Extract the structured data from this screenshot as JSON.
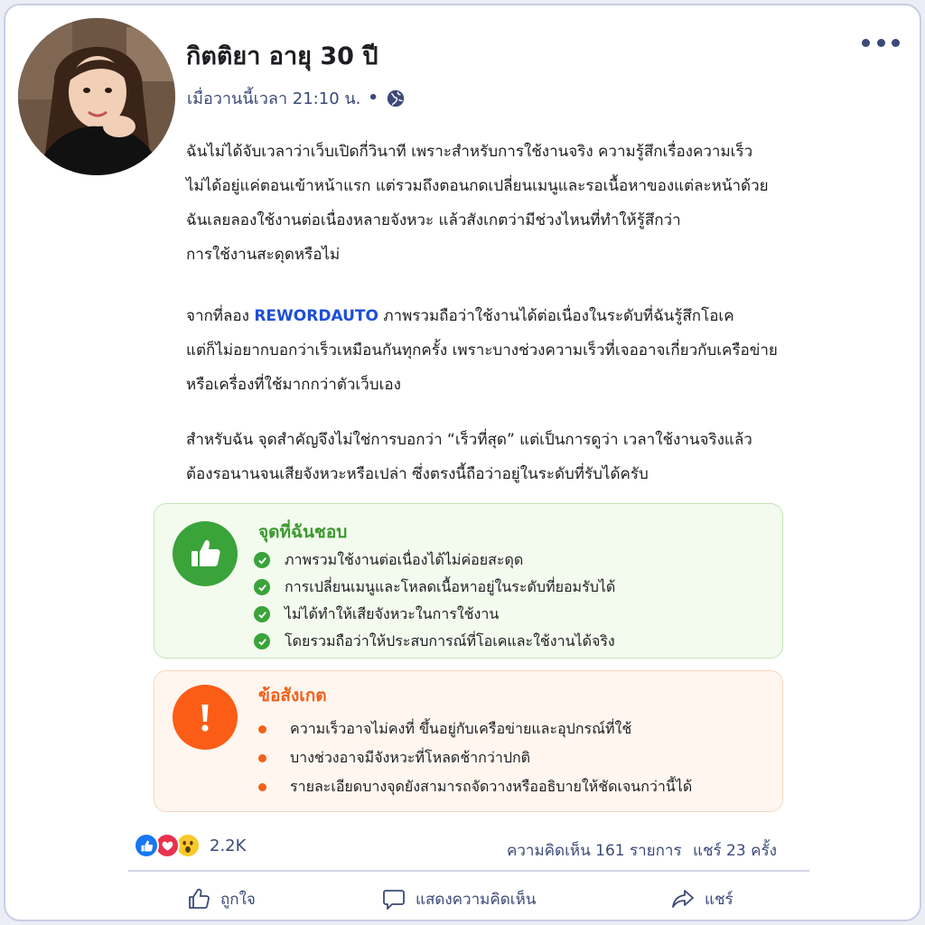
{
  "post": {
    "author": "กิตติยา อายุ 30 ปี",
    "timestamp": "เมื่อวานนี้เวลา 21:10 น.",
    "separator": "•",
    "privacy_icon": "globe-icon",
    "more_icon": "more-options-icon",
    "paragraphs": [
      {
        "lines": [
          "ฉันไม่ได้จับเวลาว่าเว็บเปิดกี่วินาที เพราะสำหรับการใช้งานจริง ความรู้สึกเรื่องความเร็ว",
          "ไม่ได้อยู่แค่ตอนเข้าหน้าแรก แต่รวมถึงตอนกดเปลี่ยนเมนูและรอเนื้อหาของแต่ละหน้าด้วย",
          "ฉันเลยลองใช้งานต่อเนื่องหลายจังหวะ แล้วสังเกตว่ามีช่วงไหนที่ทำให้รู้สึกว่า",
          "การใช้งานสะดุดหรือไม่"
        ]
      },
      {
        "line1_before": "จากที่ลอง ",
        "brand": "REWORDAUTO",
        "line1_after": " ภาพรวมถือว่าใช้งานได้ต่อเนื่องในระดับที่ฉันรู้สึกโอเค",
        "lines_rest": [
          "แต่ก็ไม่อยากบอกว่าเร็วเหมือนกันทุกครั้ง เพราะบางช่วงความเร็วที่เจออาจเกี่ยวกับเครือข่าย",
          "หรือเครื่องที่ใช้มากกว่าตัวเว็บเอง"
        ]
      },
      {
        "lines": [
          "สำหรับฉัน จุดสำคัญจึงไม่ใช่การบอกว่า “เร็วที่สุด” แต่เป็นการดูว่า เวลาใช้งานจริงแล้ว",
          "ต้องรอนานจนเสียจังหวะหรือเปล่า ซึ่งตรงนี้ถือว่าอยู่ในระดับที่รับได้ครับ"
        ]
      }
    ],
    "likes_box": {
      "title": "จุดที่ฉันชอบ",
      "icon": "thumbs-up-icon",
      "color": "#3aa33a",
      "items": [
        "ภาพรวมใช้งานต่อเนื่องได้ไม่ค่อยสะดุด",
        "การเปลี่ยนเมนูและโหลดเนื้อหาอยู่ในระดับที่ยอมรับได้",
        "ไม่ได้ทำให้เสียจังหวะในการใช้งาน",
        "โดยรวมถือว่าให้ประสบการณ์ที่โอเคและใช้งานได้จริง"
      ]
    },
    "notes_box": {
      "title": "ข้อสังเกต",
      "icon": "exclamation-icon",
      "color": "#f2611a",
      "items": [
        "ความเร็วอาจไม่คงที่ ขึ้นอยู่กับเครือข่ายและอุปกรณ์ที่ใช้",
        "บางช่วงอาจมีจังหวะที่โหลดช้ากว่าปกติ",
        "รายละเอียดบางจุดยังสามารถจัดวางหรืออธิบายให้ชัดเจนกว่านี้ได้"
      ]
    }
  },
  "stats": {
    "reaction_icons": [
      "like-reaction-icon",
      "love-reaction-icon",
      "wow-reaction-icon"
    ],
    "reactions": "2.2K",
    "comments": "ความคิดเห็น 161 รายการ",
    "shares": "แชร์ 23 ครั้ง"
  },
  "actions": {
    "like": "ถูกใจ",
    "comment": "แสดงความคิดเห็น",
    "share": "แชร์"
  }
}
